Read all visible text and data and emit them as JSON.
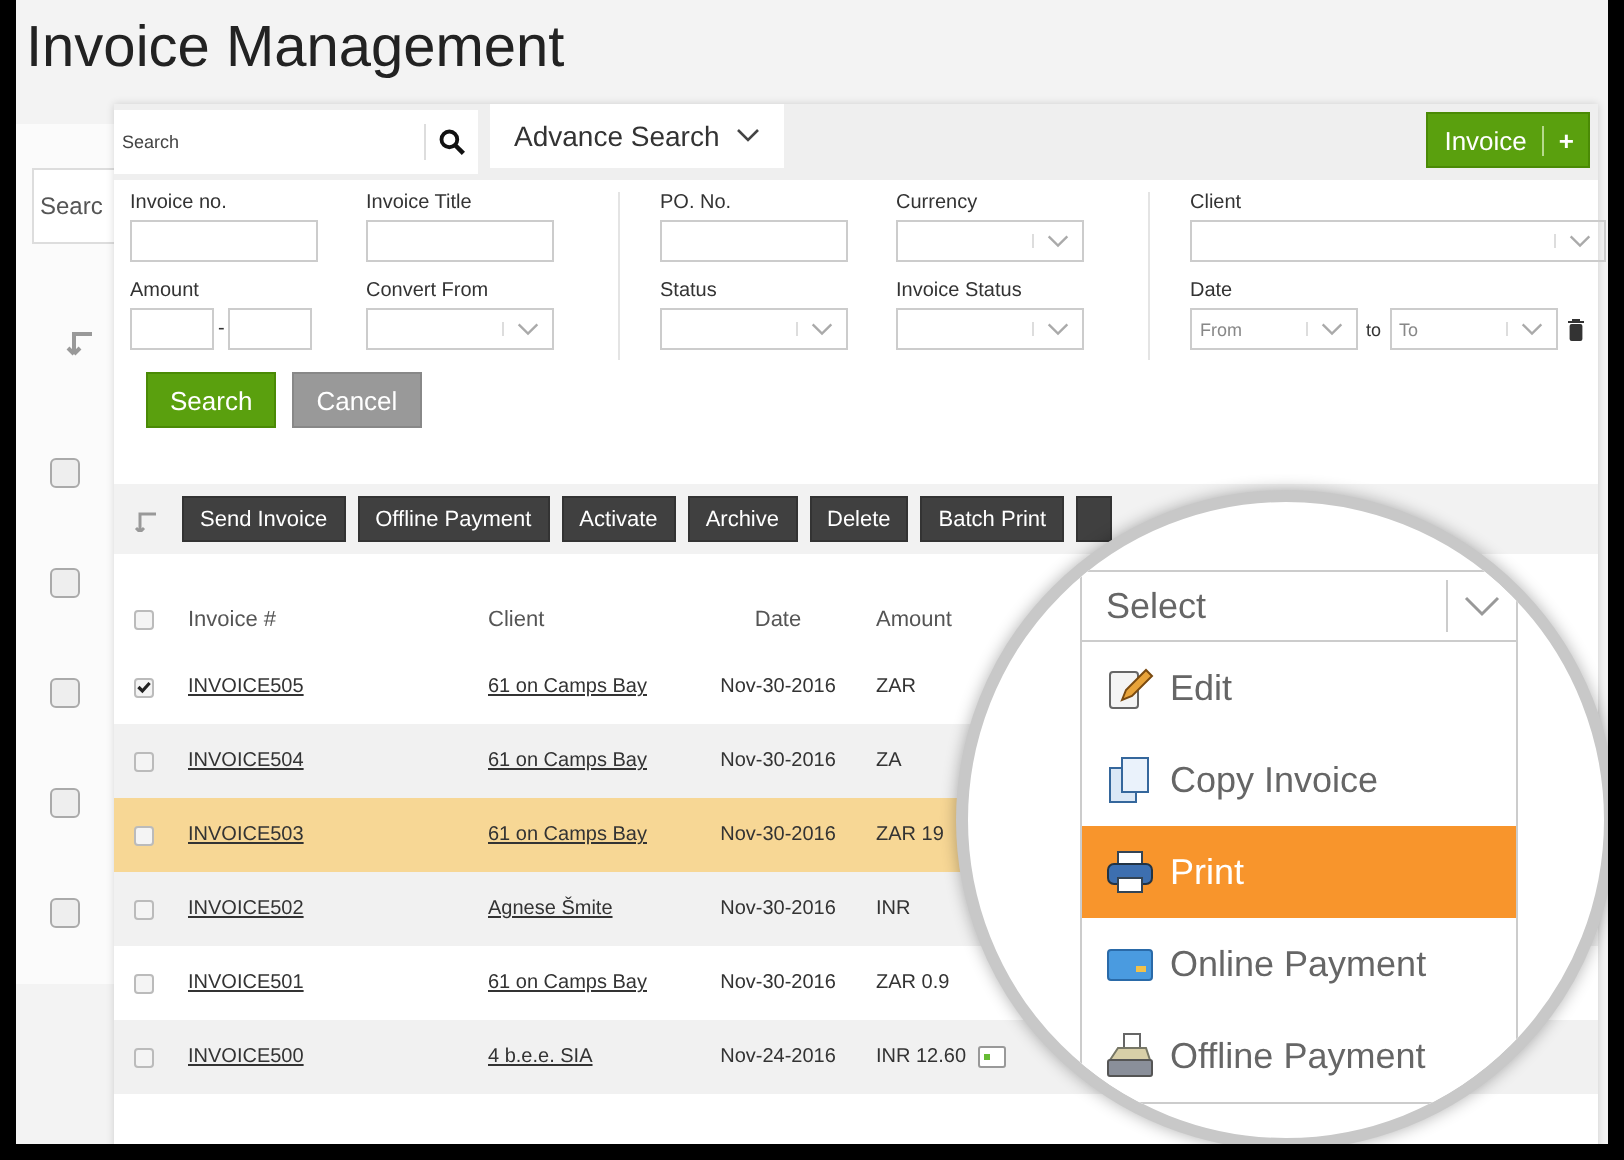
{
  "title": "Invoice Management",
  "back_page": {
    "search": {
      "placeholder": "Searc"
    },
    "row_checkboxes": [
      {
        "checked": false
      },
      {
        "checked": false
      },
      {
        "checked": false
      },
      {
        "checked": false
      },
      {
        "checked": false
      }
    ]
  },
  "panel": {
    "quick_search": {
      "placeholder": "Search"
    },
    "tab": {
      "label": "Advance Search",
      "expanded": true
    },
    "new_button": {
      "label": "Invoice",
      "plus": "+"
    },
    "filter_columns": [
      {
        "fields": [
          {
            "kind": "text",
            "label": "Invoice no."
          },
          {
            "kind": "text",
            "label": "Invoice Title"
          },
          {
            "kind": "range",
            "label": "Amount",
            "separator": "-"
          },
          {
            "kind": "select",
            "label": "Convert From"
          }
        ]
      },
      {
        "fields": [
          {
            "kind": "text",
            "label": "PO. No."
          },
          {
            "kind": "select",
            "label": "Currency"
          },
          {
            "kind": "select",
            "label": "Status"
          },
          {
            "kind": "select",
            "label": "Invoice Status"
          }
        ]
      },
      {
        "fields": [
          {
            "kind": "wide_select",
            "label": "Client"
          },
          {
            "kind": "date",
            "label": "Date",
            "from": "From",
            "to_label": "to",
            "to": "To"
          }
        ]
      }
    ],
    "buttons": [
      {
        "kind": "primary",
        "label": "Search"
      },
      {
        "kind": "secondary",
        "label": "Cancel"
      }
    ],
    "toolbar": [
      "Send Invoice",
      "Offline Payment",
      "Activate",
      "Archive",
      "Delete",
      "Batch Print"
    ],
    "table": {
      "columns": [
        "Invoice #",
        "Client",
        "Date",
        "Amount"
      ],
      "all_checked": false,
      "rows": [
        {
          "invoice": "INVOICE505",
          "client": "61 on Camps Bay",
          "date": "Nov-30-2016",
          "amount": "ZAR",
          "checked": true,
          "highlighted": false
        },
        {
          "invoice": "INVOICE504",
          "client": "61 on Camps Bay",
          "date": "Nov-30-2016",
          "amount": "ZA",
          "checked": false,
          "highlighted": false
        },
        {
          "invoice": "INVOICE503",
          "client": "61 on Camps Bay",
          "date": "Nov-30-2016",
          "amount": "ZAR 19",
          "checked": false,
          "highlighted": true
        },
        {
          "invoice": "INVOICE502",
          "client": "Agnese Šmite",
          "date": "Nov-30-2016",
          "amount": "INR",
          "checked": false,
          "highlighted": false
        },
        {
          "invoice": "INVOICE501",
          "client": "61 on Camps Bay",
          "date": "Nov-30-2016",
          "amount": "ZAR 0.9",
          "checked": false,
          "highlighted": false
        },
        {
          "invoice": "INVOICE500",
          "client": "4 b.e.e. SIA",
          "date": "Nov-24-2016",
          "amount": "INR 12.60",
          "checked": false,
          "highlighted": false,
          "has_note": true
        }
      ]
    }
  },
  "magnifier": {
    "dropdown": {
      "placeholder": "Select"
    },
    "items": [
      {
        "kind": "edit",
        "label": "Edit",
        "selected": false
      },
      {
        "kind": "copy",
        "label": "Copy Invoice",
        "selected": false
      },
      {
        "kind": "print",
        "label": "Print",
        "selected": true
      },
      {
        "kind": "online",
        "label": "Online Payment",
        "selected": false
      },
      {
        "kind": "offline",
        "label": "Offline Payment",
        "selected": false
      }
    ]
  }
}
